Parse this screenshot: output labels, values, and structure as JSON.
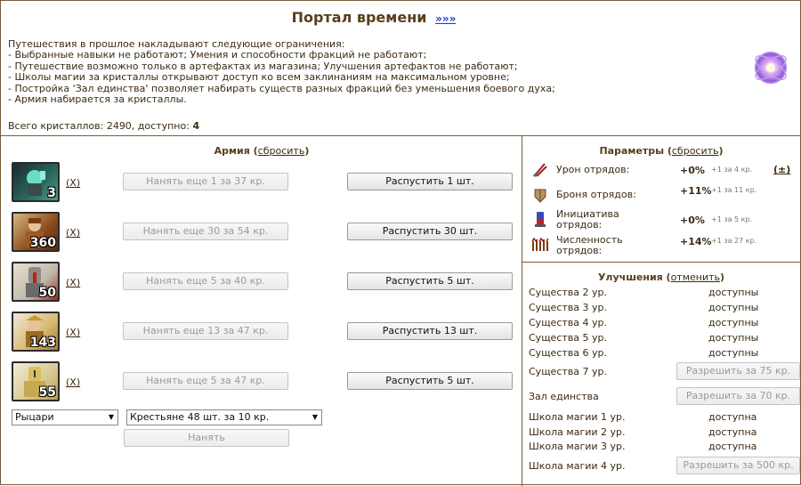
{
  "header": {
    "title": "Портал времени",
    "more_link": "»»»",
    "description": [
      "Путешествия в прошлое накладывают следующие ограничения:",
      "- Выбранные навыки не работают; Умения и способности фракций не работают;",
      "- Путешествие возможно только в артефактах из магазина; Улучшения артефактов не работают;",
      "- Школы магии за кристаллы открывают доступ ко всем заклинаниям на максимальном уровне;",
      "- Постройка 'Зал единства' позволяет набирать существ разных фракций без уменьшения боевого духа;",
      "- Армия набирается за кристаллы."
    ],
    "crystals_label": "Всего кристаллов: 2490, доступно:",
    "crystals_available": "4"
  },
  "army": {
    "title": "Армия",
    "reset_link": "сбросить",
    "remove_link": "(X)",
    "units": [
      {
        "count": "3",
        "hire_label": "Нанять еще 1 за 37 кр.",
        "dismiss_label": "Распустить 1 шт.",
        "color": "#2a6a5c"
      },
      {
        "count": "360",
        "hire_label": "Нанять еще 30 за 54 кр.",
        "dismiss_label": "Распустить 30 шт.",
        "color": "#8a4a1c"
      },
      {
        "count": "50",
        "hire_label": "Нанять еще 5 за 40 кр.",
        "dismiss_label": "Распустить 5 шт.",
        "color": "#9a2a1a"
      },
      {
        "count": "143",
        "hire_label": "Нанять еще 13 за 47 кр.",
        "dismiss_label": "Распустить 13 шт.",
        "color": "#a8782a"
      },
      {
        "count": "55",
        "hire_label": "Нанять еще 5 за 47 кр.",
        "dismiss_label": "Распустить 5 шт.",
        "color": "#b89a4a"
      }
    ],
    "faction_select": "Рыцари",
    "unit_select": "Крестьяне 48 шт. за 10 кр.",
    "hire_button": "Нанять"
  },
  "params": {
    "title": "Параметры",
    "reset_link": "сбросить",
    "plus_link": "(±)",
    "rows": [
      {
        "label1": "Урон отрядов:",
        "label2": "",
        "value": "+0%",
        "note": "+1 за 4 кр."
      },
      {
        "label1": "Броня отрядов:",
        "label2": "",
        "value": "+11%",
        "note": "+1 за 11 кр."
      },
      {
        "label1": "Инициатива",
        "label2": "отрядов:",
        "value": "+0%",
        "note": "+1 за 5 кр."
      },
      {
        "label1": "Численность",
        "label2": "отрядов:",
        "value": "+14%",
        "note": "+1 за 27 кр."
      }
    ]
  },
  "upgrades": {
    "title": "Улучшения",
    "cancel_link": "отменить",
    "rows": [
      {
        "label": "Существа 2 ур.",
        "value": "доступны",
        "button": ""
      },
      {
        "label": "Существа 3 ур.",
        "value": "доступны",
        "button": ""
      },
      {
        "label": "Существа 4 ур.",
        "value": "доступны",
        "button": ""
      },
      {
        "label": "Существа 5 ур.",
        "value": "доступны",
        "button": ""
      },
      {
        "label": "Существа 6 ур.",
        "value": "доступны",
        "button": ""
      },
      {
        "label": "Существа 7 ур.",
        "value": "",
        "button": "Разрешить за 75 кр."
      },
      {
        "label": "Зал единства",
        "value": "",
        "button": "Разрешить за 70 кр."
      },
      {
        "label": "Школа магии 1 ур.",
        "value": "доступна",
        "button": ""
      },
      {
        "label": "Школа магии 2 ур.",
        "value": "доступна",
        "button": ""
      },
      {
        "label": "Школа магии 3 ур.",
        "value": "доступна",
        "button": ""
      },
      {
        "label": "Школа магии 4 ур.",
        "value": "",
        "button": "Разрешить за 500 кр."
      }
    ]
  }
}
